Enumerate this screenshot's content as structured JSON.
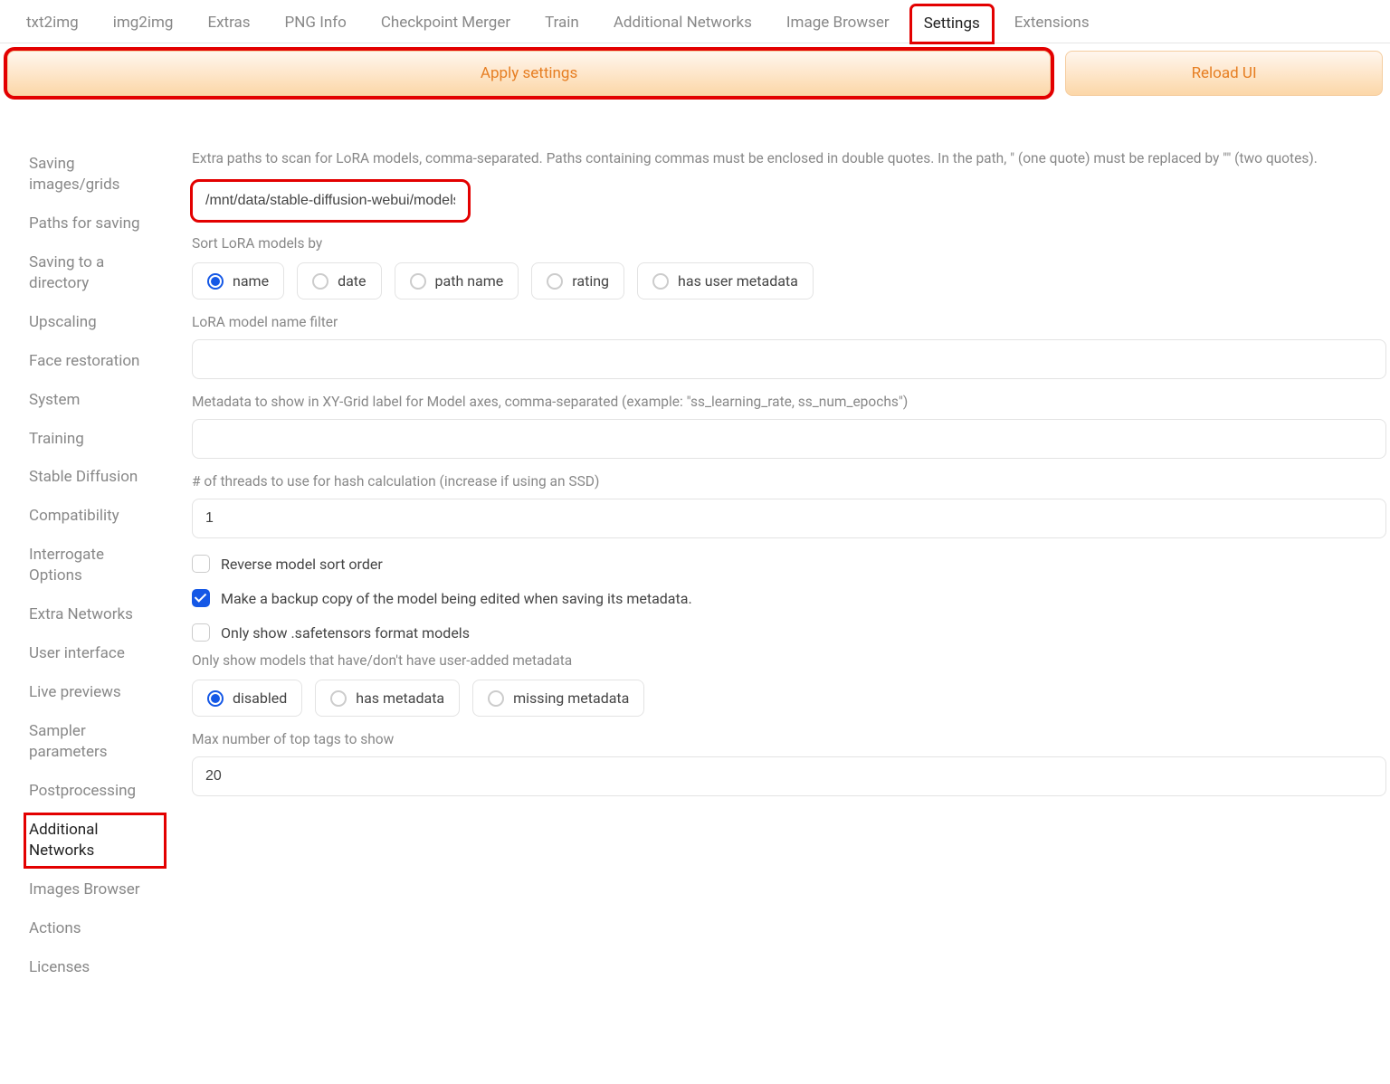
{
  "tabs": [
    {
      "label": "txt2img"
    },
    {
      "label": "img2img"
    },
    {
      "label": "Extras"
    },
    {
      "label": "PNG Info"
    },
    {
      "label": "Checkpoint Merger"
    },
    {
      "label": "Train"
    },
    {
      "label": "Additional Networks"
    },
    {
      "label": "Image Browser"
    },
    {
      "label": "Settings"
    },
    {
      "label": "Extensions"
    }
  ],
  "buttons": {
    "apply": "Apply settings",
    "reload": "Reload UI"
  },
  "sidebar": [
    {
      "label": "Saving images/grids"
    },
    {
      "label": "Paths for saving"
    },
    {
      "label": "Saving to a directory"
    },
    {
      "label": "Upscaling"
    },
    {
      "label": "Face restoration"
    },
    {
      "label": "System"
    },
    {
      "label": "Training"
    },
    {
      "label": "Stable Diffusion"
    },
    {
      "label": "Compatibility"
    },
    {
      "label": "Interrogate Options"
    },
    {
      "label": "Extra Networks"
    },
    {
      "label": "User interface"
    },
    {
      "label": "Live previews"
    },
    {
      "label": "Sampler parameters"
    },
    {
      "label": "Postprocessing"
    },
    {
      "label": "Additional Networks"
    },
    {
      "label": "Images Browser"
    },
    {
      "label": "Actions"
    },
    {
      "label": "Licenses"
    }
  ],
  "form": {
    "extraPathsDesc": "Extra paths to scan for LoRA models, comma-separated. Paths containing commas must be enclosed in double quotes. In the path, \" (one quote) must be replaced by \"\" (two quotes).",
    "extraPathsValue": "/mnt/data/stable-diffusion-webui/models/Lora",
    "sortLabel": "Sort LoRA models by",
    "sortOptions": [
      {
        "label": "name",
        "selected": true
      },
      {
        "label": "date"
      },
      {
        "label": "path name"
      },
      {
        "label": "rating"
      },
      {
        "label": "has user metadata"
      }
    ],
    "nameFilterLabel": "LoRA model name filter",
    "nameFilterValue": "",
    "metadataLabel": "Metadata to show in XY-Grid label for Model axes, comma-separated (example: \"ss_learning_rate, ss_num_epochs\")",
    "metadataValue": "",
    "threadsLabel": "# of threads to use for hash calculation (increase if using an SSD)",
    "threadsValue": "1",
    "reverseSort": {
      "label": "Reverse model sort order",
      "checked": false
    },
    "backup": {
      "label": "Make a backup copy of the model being edited when saving its metadata.",
      "checked": true
    },
    "onlySafetensors": {
      "label": "Only show .safetensors format models",
      "checked": false
    },
    "onlyMetadataLabel": "Only show models that have/don't have user-added metadata",
    "onlyMetadataOptions": [
      {
        "label": "disabled",
        "selected": true
      },
      {
        "label": "has metadata"
      },
      {
        "label": "missing metadata"
      }
    ],
    "maxTagsLabel": "Max number of top tags to show",
    "maxTagsValue": "20"
  }
}
